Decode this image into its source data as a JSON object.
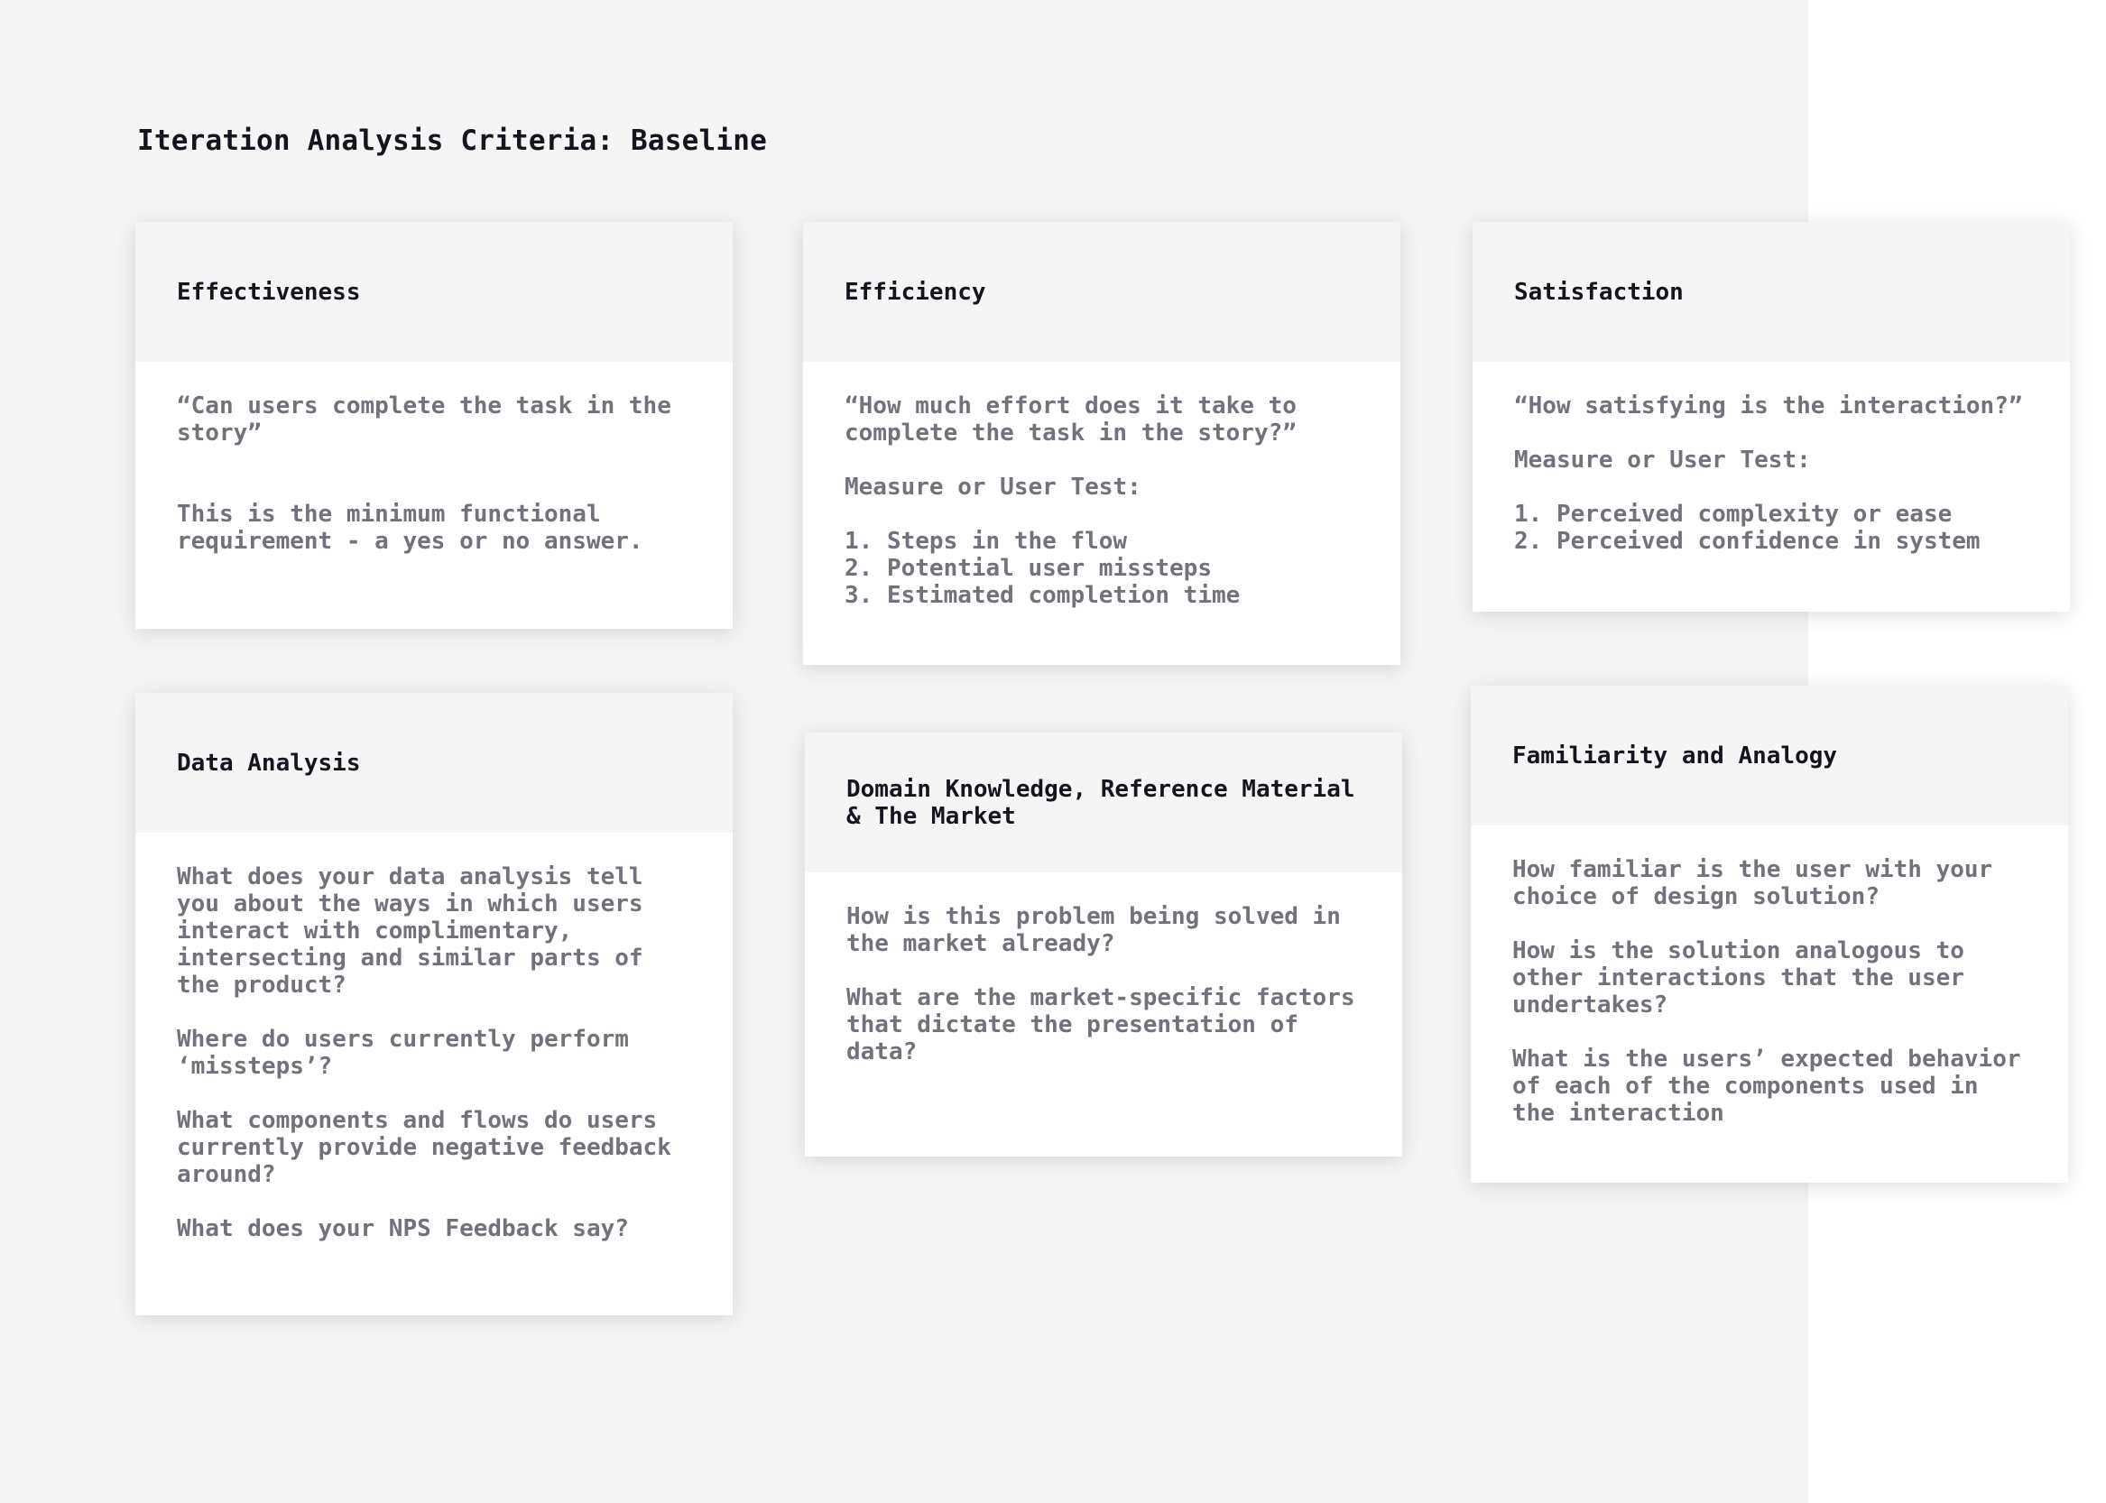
{
  "page": {
    "title": "Iteration Analysis Criteria: Baseline"
  },
  "cards": {
    "effectiveness": {
      "title": "Effectiveness",
      "question": "“Can users complete the task in the story”",
      "note": "This is the minimum functional requirement - a yes or no answer."
    },
    "efficiency": {
      "title": "Efficiency",
      "question": "“How much effort does it take to complete the task in the story?”",
      "measure_label": "Measure or User Test:",
      "items": [
        "1. Steps in the flow",
        "2. Potential user missteps",
        "3. Estimated completion time"
      ]
    },
    "satisfaction": {
      "title": "Satisfaction",
      "question": "“How satisfying is the interaction?”",
      "measure_label": "Measure or User Test:",
      "items": [
        "1. Perceived complexity or ease",
        "2. Perceived confidence in system"
      ]
    },
    "data_analysis": {
      "title": "Data Analysis",
      "paragraphs": [
        "What does your data analysis tell you about the ways in which users interact with complimentary, intersecting and similar parts of the product?",
        "Where do users currently perform ‘missteps’?",
        "What components and flows do users currently provide negative feedback around?",
        "What does your NPS Feedback say?"
      ]
    },
    "domain": {
      "title": "Domain Knowledge, Reference Material & The Market",
      "paragraphs": [
        "How is this problem being solved in the market already?",
        "What are the market-specific factors that dictate the presentation of data?"
      ]
    },
    "familiarity": {
      "title": "Familiarity and Analogy",
      "paragraphs": [
        "How familiar is the user with your choice of design solution?",
        "How is the solution analogous to other interactions that the user undertakes?",
        "What is the users’ expected behavior of each of the components used in the interaction"
      ]
    }
  }
}
